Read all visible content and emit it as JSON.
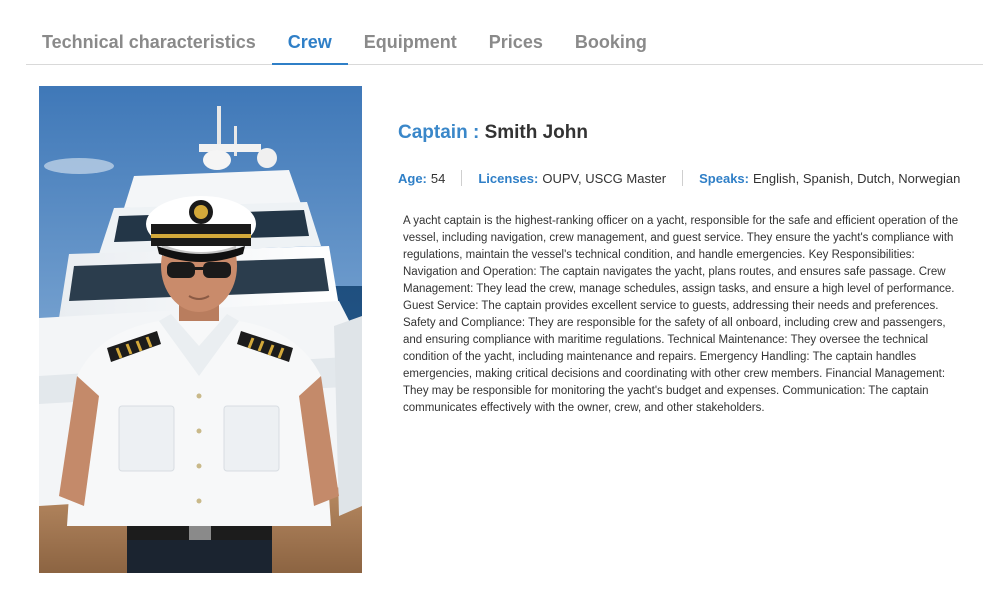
{
  "tabs": [
    {
      "label": "Technical characteristics",
      "active": false
    },
    {
      "label": "Crew",
      "active": true
    },
    {
      "label": "Equipment",
      "active": false
    },
    {
      "label": "Prices",
      "active": false
    },
    {
      "label": "Booking",
      "active": false
    }
  ],
  "crew": {
    "role": "Captain :",
    "name": "Smith John",
    "age_label": "Age:",
    "age": "54",
    "licenses_label": "Licenses:",
    "licenses": "OUPV, USCG Master",
    "speaks_label": "Speaks:",
    "speaks": "English, Spanish, Dutch, Norwegian",
    "description": "A yacht captain is the highest-ranking officer on a yacht, responsible for the safe and efficient operation of the vessel, including navigation, crew management, and guest service. They ensure the yacht's compliance with regulations, maintain the vessel's technical condition, and handle emergencies. Key Responsibilities: Navigation and Operation: The captain navigates the yacht, plans routes, and ensures safe passage. Crew Management: They lead the crew, manage schedules, assign tasks, and ensure a high level of performance. Guest Service: The captain provides excellent service to guests, addressing their needs and preferences. Safety and Compliance: They are responsible for the safety of all onboard, including crew and passengers, and ensuring compliance with maritime regulations. Technical Maintenance: They oversee the technical condition of the yacht, including maintenance and repairs. Emergency Handling: The captain handles emergencies, making critical decisions and coordinating with other crew members. Financial Management: They may be responsible for monitoring the yacht's budget and expenses. Communication: The captain communicates effectively with the owner, crew, and other stakeholders."
  },
  "colors": {
    "accent": "#2f7fc7",
    "tab_inactive": "#8a8a8a",
    "text": "#333333"
  }
}
